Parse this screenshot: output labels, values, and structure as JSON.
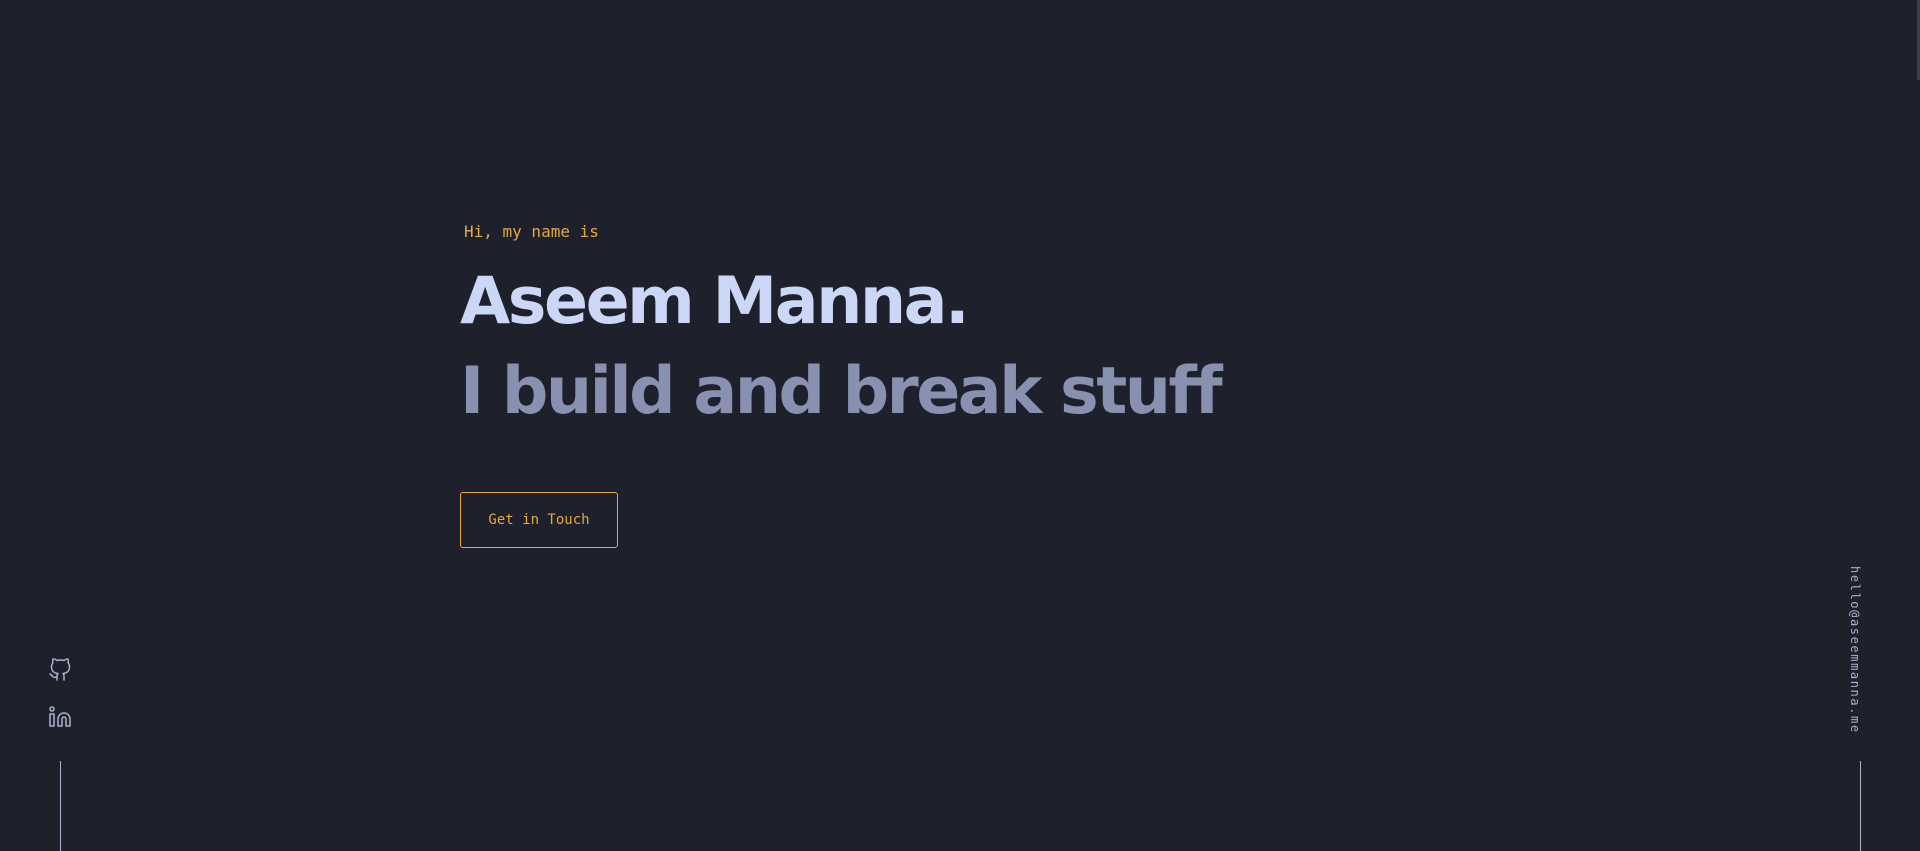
{
  "hero": {
    "greeting": "Hi, my name is",
    "name": "Aseem Manna.",
    "tagline": "I build and break stuff",
    "cta_label": "Get in Touch"
  },
  "social": {
    "items": [
      {
        "name": "GitHub",
        "icon": "github-icon"
      },
      {
        "name": "LinkedIn",
        "icon": "linkedin-icon"
      }
    ]
  },
  "contact": {
    "email": "hello@aseemmanna.me"
  },
  "colors": {
    "background": "#1e202b",
    "accent": "#e6a93a",
    "name": "#ccd6f6",
    "tagline": "#8892b0",
    "icon": "#a8b2d1",
    "line": "#a8b2d1",
    "email": "#a8b2d1",
    "scrollbar": "#3a3d4d"
  }
}
